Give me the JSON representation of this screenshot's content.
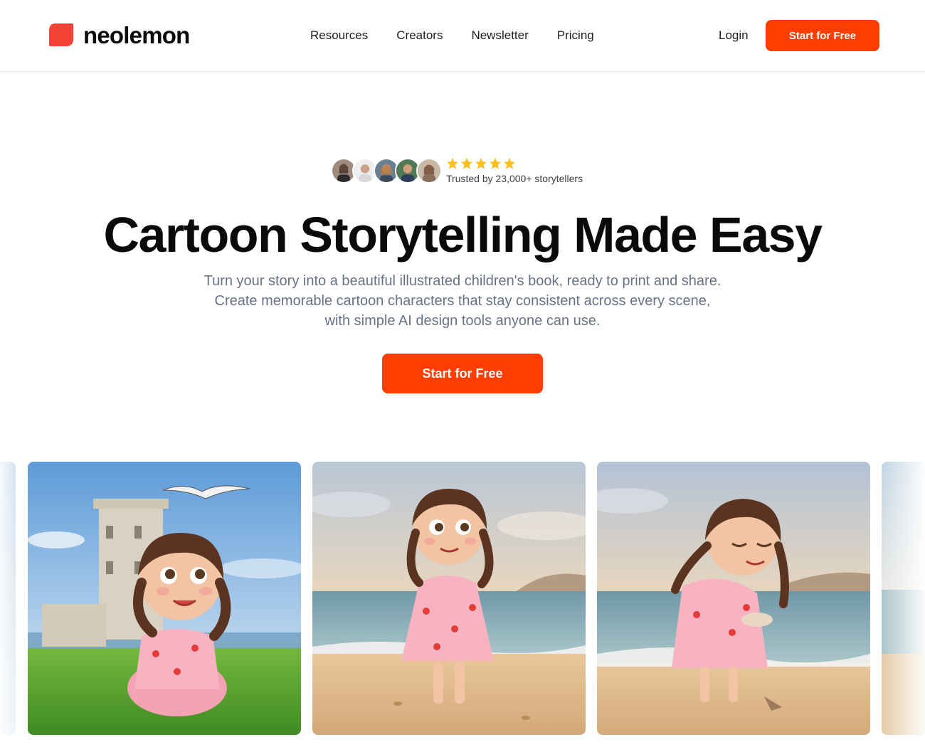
{
  "brand": {
    "name": "neolemon",
    "accent": "#ff3d00"
  },
  "nav": {
    "items": [
      "Resources",
      "Creators",
      "Newsletter",
      "Pricing"
    ],
    "login": "Login",
    "cta": "Start for Free"
  },
  "hero": {
    "rating_stars": 5,
    "trust_text": "Trusted by 23,000+ storytellers",
    "headline": "Cartoon Storytelling Made Easy",
    "sub_lines": [
      "Turn your story into a beautiful illustrated children's book, ready to print and share.",
      "Create memorable cartoon characters that stay consistent across every scene,",
      "with simple AI design tools anyone can use."
    ],
    "cta": "Start for Free"
  },
  "colors": {
    "star": "#fbbf24",
    "subtext": "#687287"
  }
}
